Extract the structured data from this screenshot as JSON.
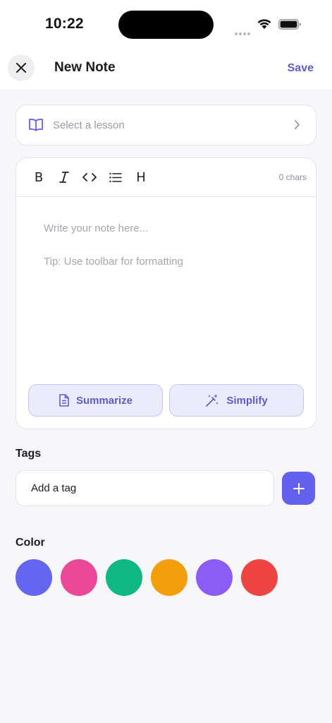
{
  "status_bar": {
    "time": "10:22"
  },
  "nav": {
    "title": "New Note",
    "save_label": "Save",
    "close_icon": "close-icon"
  },
  "lesson_select": {
    "placeholder": "Select a lesson",
    "icon": "book-open-icon",
    "chevron": "chevron-right-icon"
  },
  "editor": {
    "toolbar": [
      {
        "name": "bold",
        "label": "B",
        "icon": "bold-icon"
      },
      {
        "name": "italic",
        "icon": "italic-icon"
      },
      {
        "name": "code",
        "icon": "code-icon"
      },
      {
        "name": "list",
        "icon": "list-icon"
      },
      {
        "name": "heading",
        "label": "H",
        "icon": "heading-icon"
      }
    ],
    "char_count": "0 chars",
    "placeholder": "Write your note here...",
    "tip": "Tip: Use toolbar for formatting",
    "actions": {
      "summarize": "Summarize",
      "simplify": "Simplify"
    }
  },
  "tags": {
    "label": "Tags",
    "input_placeholder": "Add a tag"
  },
  "color": {
    "label": "Color",
    "swatches": [
      "#6366f1",
      "#ec4899",
      "#10b981",
      "#f59e0b",
      "#8b5cf6",
      "#ef4444"
    ]
  },
  "colors": {
    "accent": "#6361ee",
    "accent_text": "#5f5ccf",
    "background": "#f7f7f9"
  }
}
